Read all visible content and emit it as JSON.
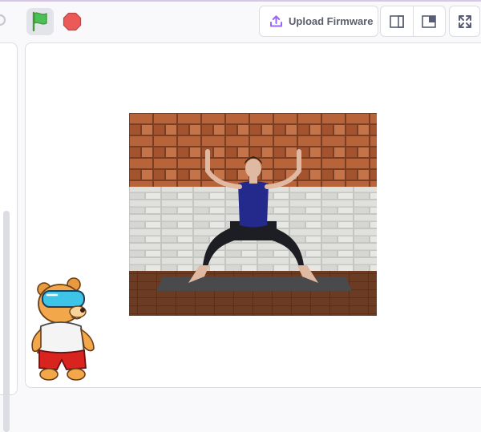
{
  "toolbar": {
    "upload_firmware_label": "Upload Firmware",
    "upload_icon": "upload-icon",
    "green_flag_icon": "green-flag-icon",
    "stop_icon": "stop-icon",
    "small_stage_icon": "small-stage-layout-icon",
    "large_stage_icon": "large-stage-layout-icon",
    "fullscreen_icon": "fullscreen-icon"
  },
  "stage": {
    "backdrop_description": "yoga-pose-photo",
    "sprite": "bear-mascot-with-goggles"
  },
  "colors": {
    "flag_green": "#4cbf56",
    "stop_red": "#ec5959",
    "accent_purple": "#9966ff",
    "border": "#dcdde2"
  }
}
